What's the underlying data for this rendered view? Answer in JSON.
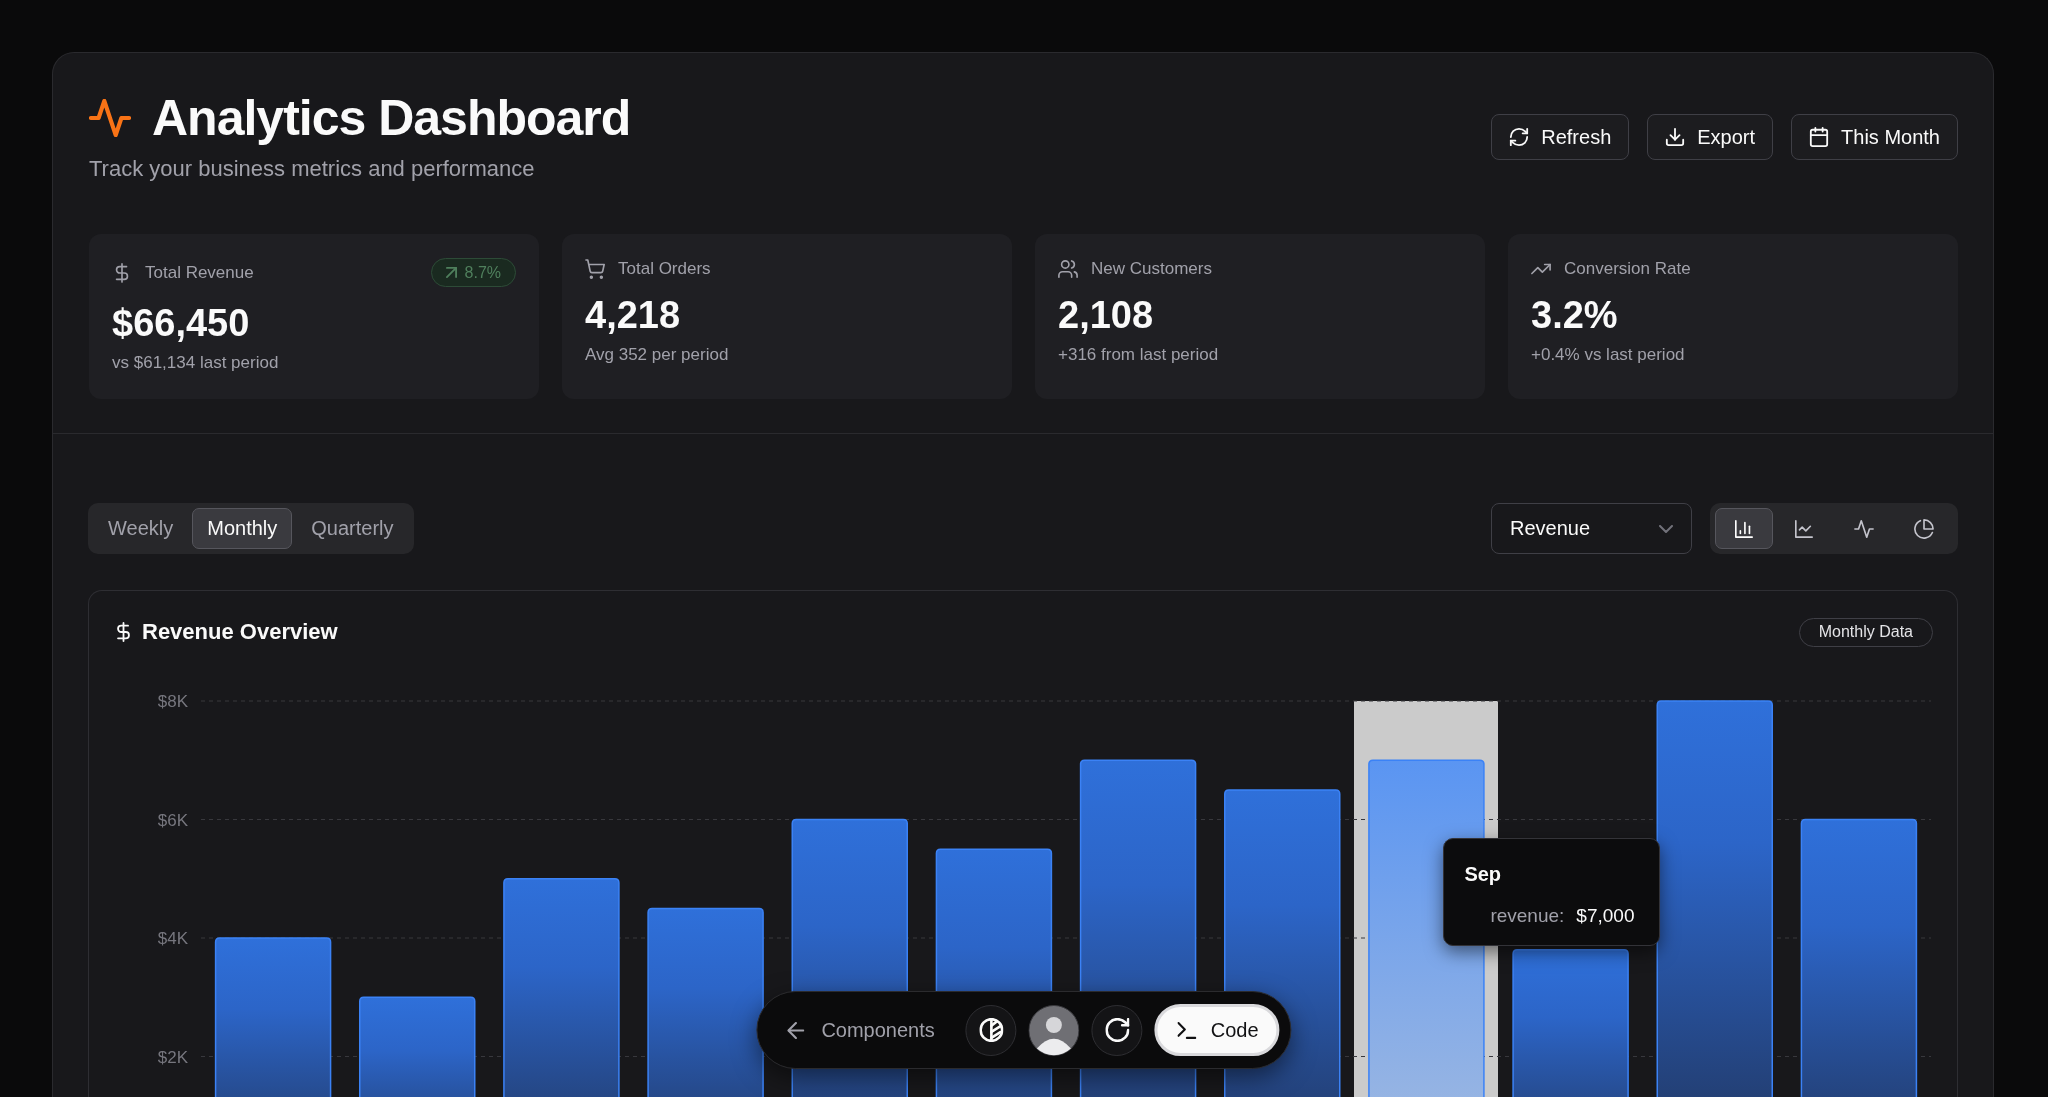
{
  "header": {
    "title": "Analytics Dashboard",
    "subtitle": "Track your business metrics and performance",
    "actions": [
      {
        "kind": "refresh",
        "label": "Refresh"
      },
      {
        "kind": "export",
        "label": "Export"
      },
      {
        "kind": "date_range",
        "label": "This Month"
      }
    ]
  },
  "stats": [
    {
      "kind": "revenue",
      "label": "Total Revenue",
      "value": "$66,450",
      "note": "vs $61,134 last period",
      "badge": "8.7%"
    },
    {
      "kind": "orders",
      "label": "Total Orders",
      "value": "4,218",
      "note": "Avg 352 per period"
    },
    {
      "kind": "customers",
      "label": "New Customers",
      "value": "2,108",
      "note": "+316 from last period"
    },
    {
      "kind": "conversion",
      "label": "Conversion Rate",
      "value": "3.2%",
      "note": "+0.4% vs last period"
    }
  ],
  "periods": [
    {
      "label": "Weekly",
      "selected": false
    },
    {
      "label": "Monthly",
      "selected": true
    },
    {
      "label": "Quarterly",
      "selected": false
    }
  ],
  "metric_select": {
    "value": "Revenue"
  },
  "chart_types": [
    {
      "kind": "bar",
      "selected": true
    },
    {
      "kind": "line",
      "selected": false
    },
    {
      "kind": "pulse",
      "selected": false
    },
    {
      "kind": "pie",
      "selected": false
    }
  ],
  "chart_card": {
    "badge": "Monthly Data",
    "chart_data": {
      "type": "bar",
      "title": "Revenue Overview",
      "values": [
        4000,
        3000,
        5000,
        4500,
        6000,
        5500,
        7000,
        6500,
        7000,
        3800,
        8000,
        6000
      ],
      "ylim": [
        0,
        8000
      ],
      "yticks": [
        {
          "value": 2000,
          "label": "$2K"
        },
        {
          "value": 4000,
          "label": "$4K"
        },
        {
          "value": 6000,
          "label": "$6K"
        },
        {
          "value": 8000,
          "label": "$8K"
        }
      ],
      "grid": true
    },
    "bars": [
      {
        "hovered": false
      },
      {
        "hovered": false
      },
      {
        "hovered": false
      },
      {
        "hovered": false
      },
      {
        "hovered": false
      },
      {
        "hovered": false
      },
      {
        "hovered": false
      },
      {
        "hovered": false
      },
      {
        "hovered": true
      },
      {
        "hovered": false
      },
      {
        "hovered": false
      },
      {
        "hovered": false
      }
    ],
    "tooltip": {
      "title": "Sep",
      "label": "revenue:",
      "value": "$7,000"
    }
  },
  "dock": {
    "back_label": "Components",
    "code_label": "Code"
  }
}
